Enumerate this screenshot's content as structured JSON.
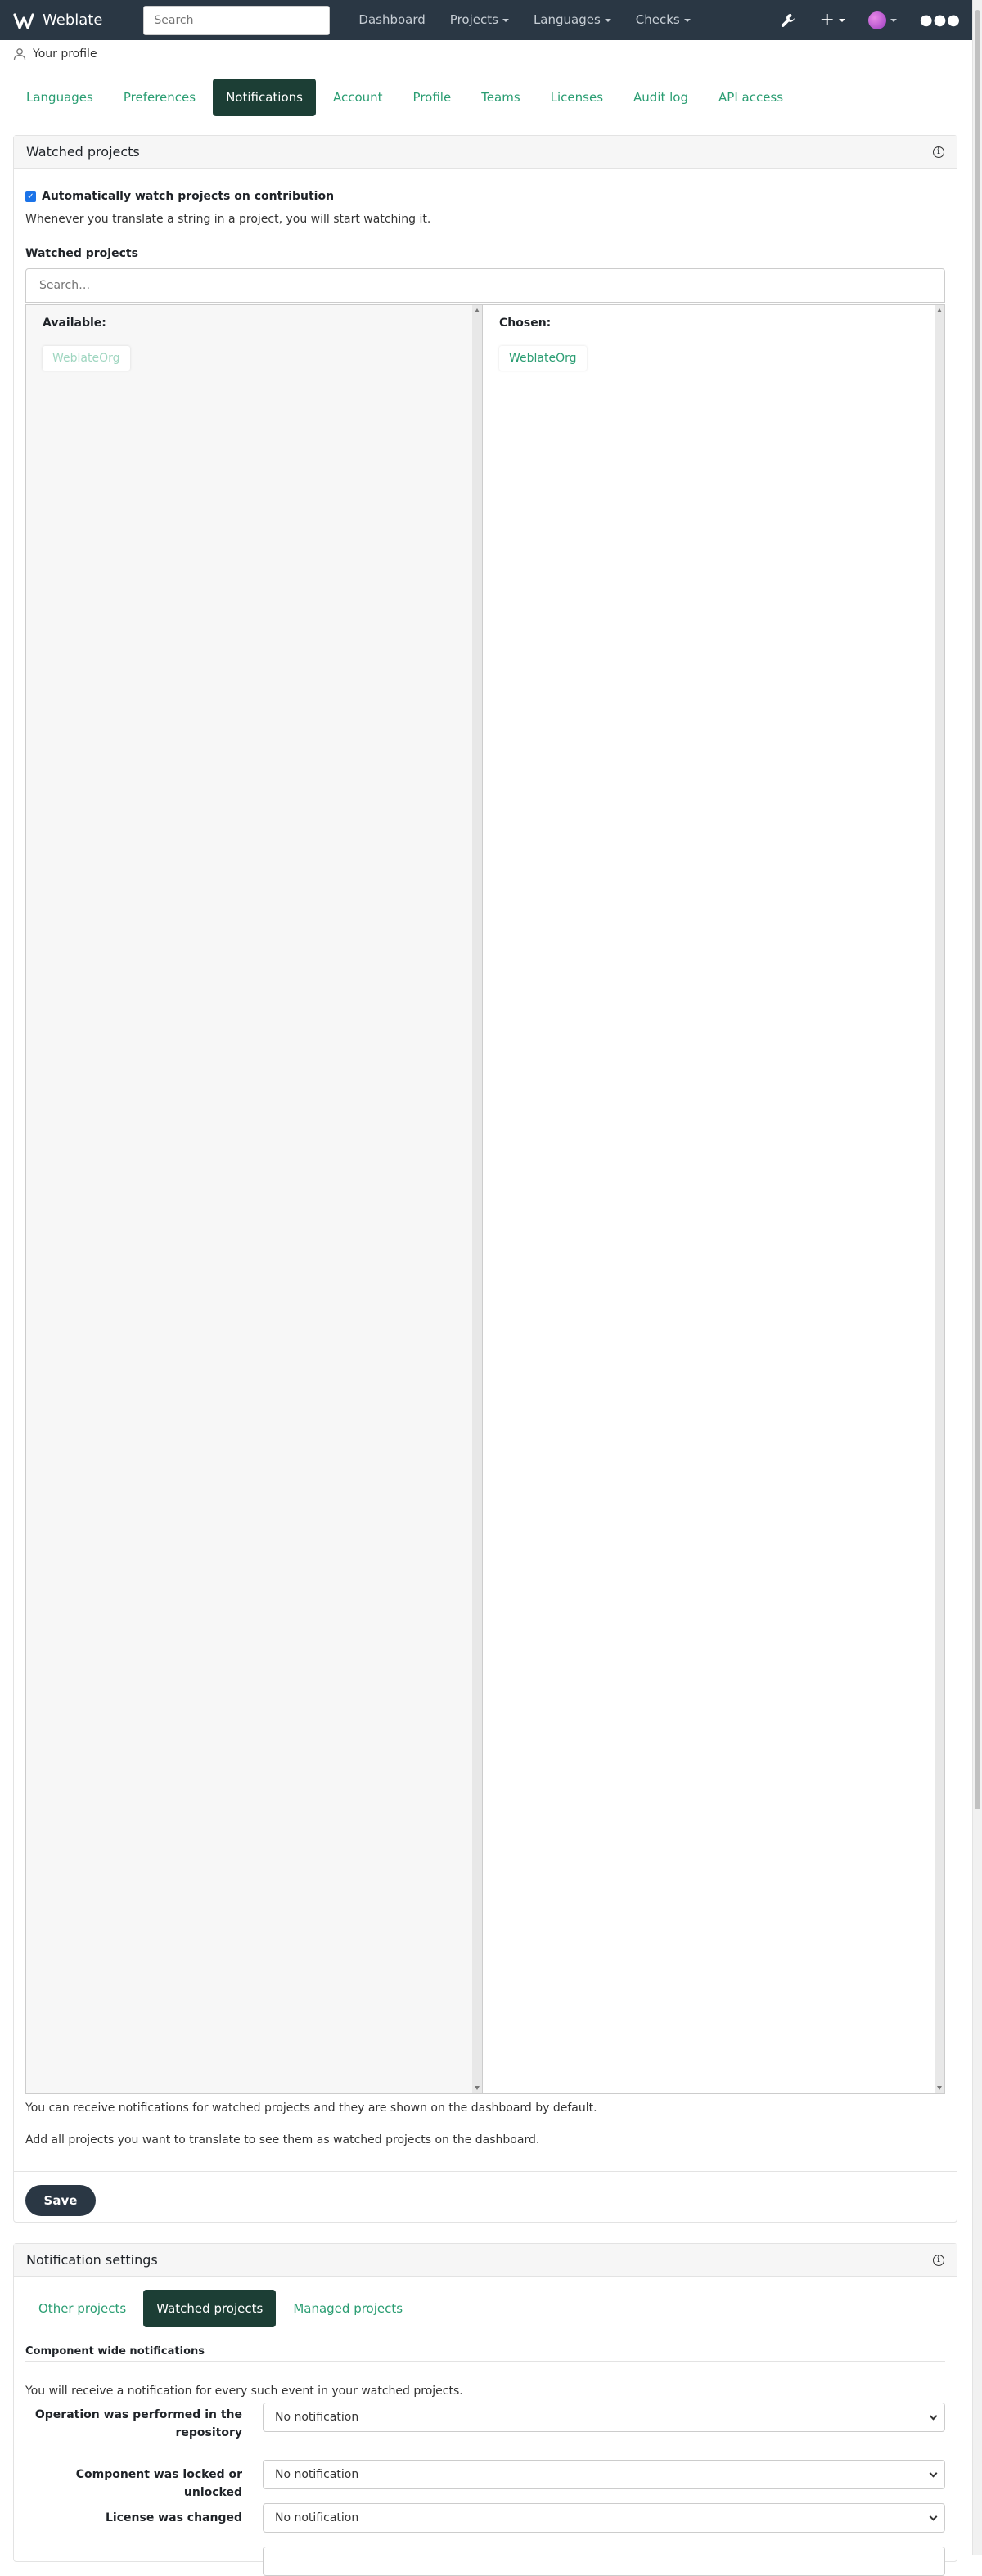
{
  "navbar": {
    "brand": "Weblate",
    "search_placeholder": "Search",
    "links": [
      "Dashboard",
      "Projects",
      "Languages",
      "Checks"
    ]
  },
  "breadcrumb": {
    "label": "Your profile"
  },
  "tabs": [
    "Languages",
    "Preferences",
    "Notifications",
    "Account",
    "Profile",
    "Teams",
    "Licenses",
    "Audit log",
    "API access"
  ],
  "watched": {
    "title": "Watched projects",
    "auto_watch_label": "Automatically watch projects on contribution",
    "auto_watch_help": "Whenever you translate a string in a project, you will start watching it.",
    "field_label": "Watched projects",
    "search_placeholder": "Search…",
    "available_label": "Available:",
    "chosen_label": "Chosen:",
    "available_items": [
      "WeblateOrg"
    ],
    "chosen_items": [
      "WeblateOrg"
    ],
    "help_1": "You can receive notifications for watched projects and they are shown on the dashboard by default.",
    "help_2": "Add all projects you want to translate to see them as watched projects on the dashboard.",
    "save_label": "Save"
  },
  "notifications": {
    "title": "Notification settings",
    "subtabs": [
      "Other projects",
      "Watched projects",
      "Managed projects"
    ],
    "section_title": "Component wide notifications",
    "section_help": "You will receive a notification for every such event in your watched projects.",
    "rows": [
      {
        "label": "Operation was performed in the repository",
        "value": "No notification"
      },
      {
        "label": "Component was locked or unlocked",
        "value": "No notification"
      },
      {
        "label": "License was changed",
        "value": "No notification"
      }
    ]
  },
  "colors": {
    "navbar": "#2a3744",
    "accent": "#2a9d72",
    "active_tab": "#1c3e35"
  }
}
